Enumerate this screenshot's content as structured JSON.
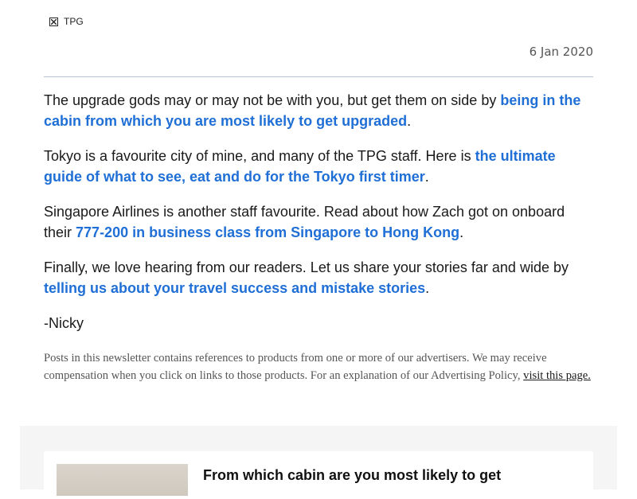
{
  "header": {
    "brand_label": "TPG",
    "date": "6 Jan 2020"
  },
  "body": {
    "p1": {
      "text": "The upgrade gods may or may not be with you, but get them on side by ",
      "link": "being in the cabin from which you are most likely to get upgraded",
      "after": "."
    },
    "p2": {
      "text": "Tokyo is a favourite city of mine, and many of the TPG staff. Here is ",
      "link": "the ultimate guide of what to see, eat and do for the Tokyo first timer",
      "after": "."
    },
    "p3": {
      "text": "Singapore Airlines is another staff favourite. Read about how Zach got on onboard their ",
      "link": "777-200 in business class from Singapore to Hong Kong",
      "after": "."
    },
    "p4": {
      "text": "Finally, we love hearing from our readers. Let us share your stories far and wide by ",
      "link": "telling us about your travel success and mistake stories",
      "after": "."
    },
    "signoff": "-Nicky"
  },
  "disclaimer": {
    "text": "Posts in this newsletter contains references to products from one or more of our advertisers. We may receive compensation when you click on links to those products. For an explanation of our Advertising Policy, ",
    "link": "visit this page."
  },
  "card": {
    "title": "From which cabin are you most likely to get"
  },
  "colors": {
    "link": "#1f6fd6",
    "band": "#f5f5f5",
    "divider": "#b8c3d6"
  }
}
